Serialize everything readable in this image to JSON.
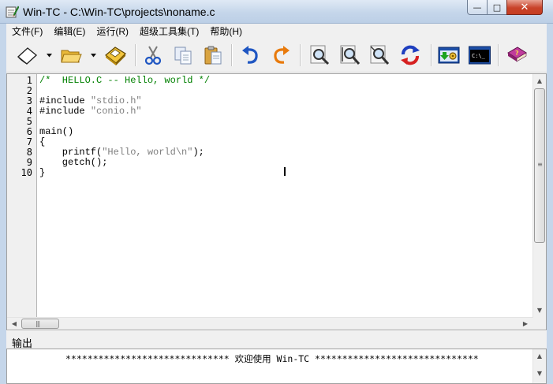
{
  "window": {
    "title": "Win-TC - C:\\Win-TC\\projects\\noname.c",
    "minimize_glyph": "—",
    "maximize_glyph": "□",
    "close_glyph": "✕"
  },
  "menu": {
    "items": [
      "文件(F)",
      "编辑(E)",
      "运行(R)",
      "超级工具集(T)",
      "帮助(H)"
    ]
  },
  "toolbar": {
    "buttons": [
      {
        "name": "new-file",
        "icon": "blank-page-icon"
      },
      {
        "name": "open-file",
        "icon": "folder-icon"
      },
      {
        "name": "save-file",
        "icon": "floppy-disk-icon"
      },
      {
        "name": "cut",
        "icon": "scissors-icon"
      },
      {
        "name": "copy",
        "icon": "copy-icon"
      },
      {
        "name": "paste",
        "icon": "clipboard-icon"
      },
      {
        "name": "undo",
        "icon": "undo-arrow-icon"
      },
      {
        "name": "redo",
        "icon": "redo-arrow-icon"
      },
      {
        "name": "find",
        "icon": "magnifier-icon"
      },
      {
        "name": "find-next",
        "icon": "magnifier-next-icon"
      },
      {
        "name": "replace",
        "icon": "magnifier-replace-icon"
      },
      {
        "name": "refresh",
        "icon": "refresh-icon"
      },
      {
        "name": "compile-run",
        "icon": "compile-gear-icon"
      },
      {
        "name": "console",
        "icon": "console-icon"
      },
      {
        "name": "help-book",
        "icon": "help-book-icon"
      }
    ],
    "console_label": "C:\\_"
  },
  "editor": {
    "line_numbers": [
      "1",
      "2",
      "3",
      "4",
      "5",
      "6",
      "7",
      "8",
      "9",
      "10"
    ],
    "lines": [
      {
        "parts": [
          {
            "t": "/*  HELLO.C -- Hello, world */",
            "c": "comment"
          }
        ]
      },
      {
        "parts": []
      },
      {
        "parts": [
          {
            "t": "#include ",
            "c": "black"
          },
          {
            "t": "\"stdio.h\"",
            "c": "string"
          }
        ]
      },
      {
        "parts": [
          {
            "t": "#include ",
            "c": "black"
          },
          {
            "t": "\"conio.h\"",
            "c": "string"
          }
        ]
      },
      {
        "parts": []
      },
      {
        "parts": [
          {
            "t": "main()",
            "c": "black"
          }
        ]
      },
      {
        "parts": [
          {
            "t": "{",
            "c": "black"
          }
        ]
      },
      {
        "parts": [
          {
            "t": "    printf(",
            "c": "black"
          },
          {
            "t": "\"Hello, world\\n\"",
            "c": "string"
          },
          {
            "t": ");",
            "c": "black"
          }
        ]
      },
      {
        "parts": [
          {
            "t": "    getch();",
            "c": "black"
          }
        ]
      },
      {
        "parts": [
          {
            "t": "}",
            "c": "black"
          }
        ]
      }
    ]
  },
  "output": {
    "title": "输出",
    "line": "****************************** 欢迎使用 Win-TC ******************************"
  },
  "colors": {
    "comment": "#008000",
    "string": "#808080",
    "code": "#000000"
  }
}
